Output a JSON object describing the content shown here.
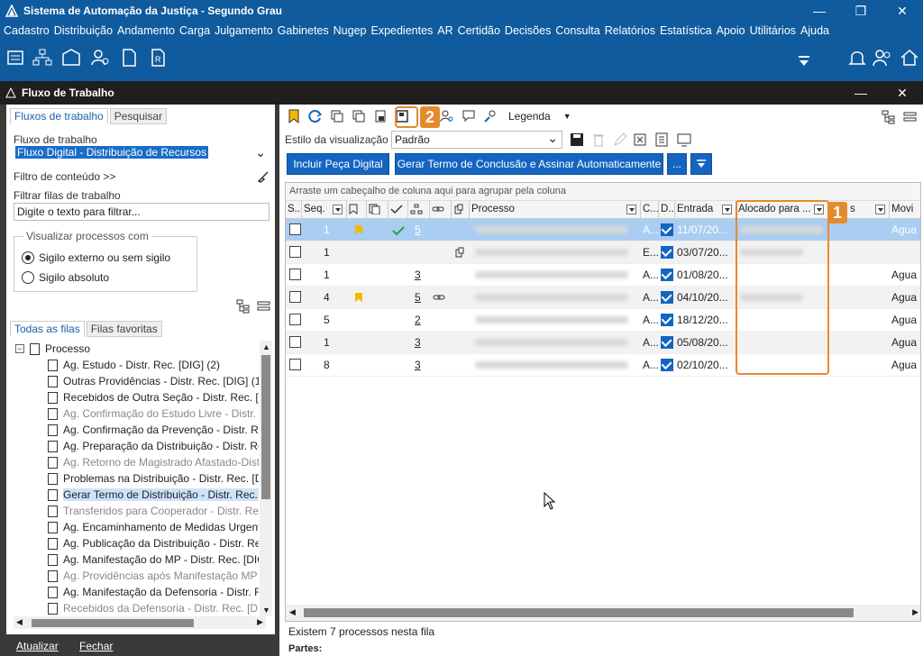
{
  "window": {
    "title": "Sistema de Automação da Justiça - Segundo Grau"
  },
  "menu": [
    "Cadastro",
    "Distribuição",
    "Andamento",
    "Carga",
    "Julgamento",
    "Gabinetes",
    "Nugep",
    "Expedientes",
    "AR",
    "Certidão",
    "Decisões",
    "Consulta",
    "Relatórios",
    "Estatística",
    "Apoio",
    "Utilitários",
    "Ajuda"
  ],
  "panel": {
    "title": "Fluxo de Trabalho"
  },
  "left": {
    "tabs": [
      "Fluxos de trabalho",
      "Pesquisar"
    ],
    "flow_label": "Fluxo de trabalho",
    "flow_value": "Fluxo Digital - Distribuição de Recursos",
    "content_filter": "Filtro de conteúdo >>",
    "filter_queues_label": "Filtrar filas de trabalho",
    "filter_placeholder": "Digite o texto para filtrar...",
    "view_group": "Visualizar processos com",
    "radio1": "Sigilo externo ou sem sigilo",
    "radio2": "Sigilo absoluto",
    "queue_tabs": [
      "Todas as filas",
      "Filas favoritas"
    ],
    "tree_root": "Processo",
    "tree": [
      {
        "t": "Ag. Estudo - Distr. Rec. [DIG] (2)",
        "grey": false
      },
      {
        "t": "Outras Providências - Distr. Rec. [DIG] (1)",
        "grey": false
      },
      {
        "t": "Recebidos de Outra Seção - Distr. Rec. [DIG",
        "grey": false
      },
      {
        "t": "Ag. Confirmação do Estudo Livre - Distr. Re",
        "grey": true
      },
      {
        "t": "Ag. Confirmação da Prevenção - Distr. Rec.",
        "grey": false
      },
      {
        "t": "Ag. Preparação da Distribuição - Distr. Rec.",
        "grey": false
      },
      {
        "t": "Ag. Retorno de Magistrado Afastado-Distri",
        "grey": true
      },
      {
        "t": "Problemas na Distribuição - Distr. Rec. [DIG",
        "grey": false
      },
      {
        "t": "Gerar Termo de Distribuição - Distr. Rec. [D",
        "grey": false,
        "hl": true
      },
      {
        "t": "Transferidos para Cooperador - Distr. Rec.",
        "grey": true
      },
      {
        "t": "Ag. Encaminhamento de Medidas Urgente",
        "grey": false
      },
      {
        "t": "Ag. Publicação da Distribuição - Distr. Rec.",
        "grey": false
      },
      {
        "t": "Ag. Manifestação do MP - Distr. Rec. [DIG]",
        "grey": false
      },
      {
        "t": "Ag. Providências após Manifestação MP Di",
        "grey": true
      },
      {
        "t": "Ag. Manifestação da Defensoria - Distr. Rec.",
        "grey": false
      },
      {
        "t": "Recebidos da Defensoria - Distr. Rec. [DIG]",
        "grey": true
      }
    ],
    "refresh": "Atualizar",
    "close": "Fechar"
  },
  "right": {
    "legend": "Legenda",
    "view_style_label": "Estilo da visualização",
    "view_style_value": "Padrão",
    "btn_include": "Incluir Peça Digital",
    "btn_generate": "Gerar Termo de Conclusão e Assinar Automaticamente",
    "btn_more": "...",
    "group_hint": "Arraste um cabeçalho de coluna aqui para agrupar pela coluna",
    "columns": [
      "S...",
      "Seq.",
      "C...",
      "D...",
      "Entrada",
      "Alocado para ...",
      "s",
      "Movi"
    ],
    "col_proc": "Processo",
    "rows": [
      {
        "seq": "1",
        "n": "5",
        "c": "A...",
        "date": "11/07/20...",
        "mov": "Agua"
      },
      {
        "seq": "1",
        "n": "",
        "c": "E...",
        "date": "03/07/20...",
        "mov": ""
      },
      {
        "seq": "1",
        "n": "3",
        "c": "A...",
        "date": "01/08/20...",
        "mov": "Agua"
      },
      {
        "seq": "4",
        "n": "5",
        "c": "A...",
        "date": "04/10/20...",
        "mov": "Agua"
      },
      {
        "seq": "5",
        "n": "2",
        "c": "A...",
        "date": "18/12/20...",
        "mov": "Agua"
      },
      {
        "seq": "1",
        "n": "3",
        "c": "A...",
        "date": "05/08/20...",
        "mov": "Agua"
      },
      {
        "seq": "8",
        "n": "3",
        "c": "A...",
        "date": "02/10/20...",
        "mov": "Agua"
      }
    ],
    "status": "Existem 7 processos nesta fila",
    "parts": "Partes:",
    "badge1": "1",
    "badge2": "2"
  }
}
